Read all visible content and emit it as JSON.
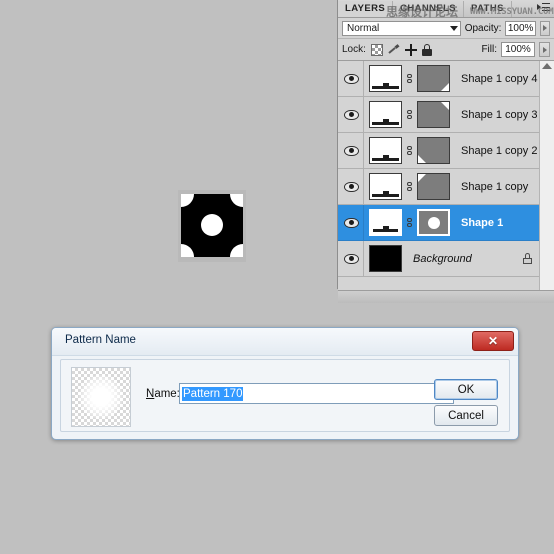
{
  "app": "Adobe Photoshop",
  "watermark": {
    "chinese": "思缘设计论坛",
    "english": "WWW.MISSYUAN.COM"
  },
  "layers_panel": {
    "tabs": [
      {
        "label": "LAYERS",
        "active": true
      },
      {
        "label": "CHANNELS",
        "active": false
      },
      {
        "label": "PATHS",
        "active": false
      }
    ],
    "menu_icon": "panel-menu-icon",
    "blend_mode": {
      "value": "Normal",
      "caret_icon": "chevron-down-icon"
    },
    "opacity": {
      "label": "Opacity:",
      "value": "100%",
      "stepper_icon": "spinner-arrow-icon"
    },
    "lock": {
      "label": "Lock:",
      "icons": [
        "lock-transparent-pixels-icon",
        "lock-image-pixels-icon",
        "lock-position-icon",
        "lock-all-icon"
      ]
    },
    "fill": {
      "label": "Fill:",
      "value": "100%",
      "stepper_icon": "spinner-arrow-icon"
    },
    "layers": [
      {
        "name": "Shape 1 copy 4",
        "visible": true,
        "selected": false,
        "type": "shape",
        "mask_corner": "br",
        "italic": false
      },
      {
        "name": "Shape 1 copy 3",
        "visible": true,
        "selected": false,
        "type": "shape",
        "mask_corner": "tr",
        "italic": false
      },
      {
        "name": "Shape 1 copy 2",
        "visible": true,
        "selected": false,
        "type": "shape",
        "mask_corner": "bl",
        "italic": false
      },
      {
        "name": "Shape 1 copy",
        "visible": true,
        "selected": false,
        "type": "shape",
        "mask_corner": "tl",
        "italic": false
      },
      {
        "name": "Shape 1",
        "visible": true,
        "selected": true,
        "type": "shape",
        "mask_corner": "circle",
        "italic": false
      },
      {
        "name": "Background",
        "visible": true,
        "selected": false,
        "type": "background",
        "mask_corner": "none",
        "italic": true,
        "locked": true
      }
    ],
    "scrollbar": {
      "arrow_icon": "scroll-up-arrow-icon"
    },
    "selection_color": "#2e8fe0"
  },
  "canvas": {
    "shape_description": "black-square-with-rounded-corner-cutouts-and-center-circle",
    "fill_color": "#000000",
    "cutout_color": "#ffffff"
  },
  "dialog": {
    "title": "Pattern Name",
    "close_icon": "close-x-icon",
    "preview": "pattern-preview-thumbnail",
    "name_label_prefix": "N",
    "name_label_rest": "ame:",
    "name_value": "Pattern 170",
    "name_selected": true,
    "ok_label": "OK",
    "cancel_label": "Cancel"
  }
}
